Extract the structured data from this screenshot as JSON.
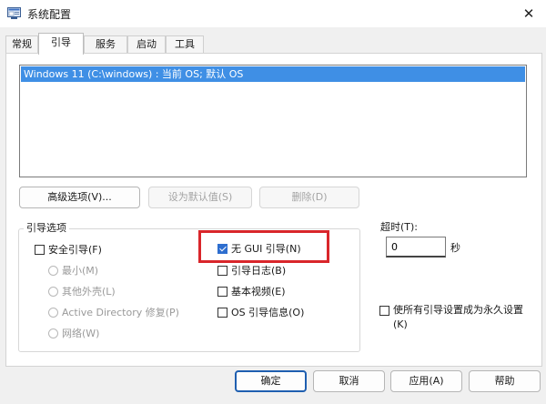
{
  "window": {
    "title": "系统配置",
    "close_glyph": "✕"
  },
  "tabs": [
    {
      "label": "常规",
      "active": false
    },
    {
      "label": "引导",
      "active": true
    },
    {
      "label": "服务",
      "active": false
    },
    {
      "label": "启动",
      "active": false
    },
    {
      "label": "工具",
      "active": false
    }
  ],
  "os_list": {
    "items": [
      "Windows 11 (C:\\windows) : 当前 OS; 默认 OS"
    ],
    "selected_index": 0
  },
  "actions": {
    "advanced": "高级选项(V)...",
    "set_default": "设为默认值(S)",
    "delete": "删除(D)"
  },
  "boot_options": {
    "group_label": "引导选项",
    "safe_boot": {
      "label": "安全引导(F)",
      "checked": false
    },
    "radios": [
      "最小(M)",
      "其他外壳(L)",
      "Active Directory 修复(P)",
      "网络(W)"
    ],
    "no_gui": {
      "label": "无 GUI 引导(N)",
      "checked": true
    },
    "boot_log": {
      "label": "引导日志(B)",
      "checked": false
    },
    "base_video": {
      "label": "基本视频(E)",
      "checked": false
    },
    "os_boot_info": {
      "label": "OS 引导信息(O)",
      "checked": false
    }
  },
  "timeout": {
    "label": "超时(T):",
    "value": "0",
    "unit": "秒"
  },
  "permanent": {
    "label": "使所有引导设置成为永久设置(K)",
    "checked": false
  },
  "footer": {
    "ok": "确定",
    "cancel": "取消",
    "apply": "应用(A)",
    "help": "帮助"
  },
  "colors": {
    "selection": "#3f8fe5",
    "highlight_box": "#d9262b",
    "check_fill": "#2e6ecf"
  },
  "icons": {
    "app": "msconfig-window-icon",
    "close": "close-icon"
  }
}
